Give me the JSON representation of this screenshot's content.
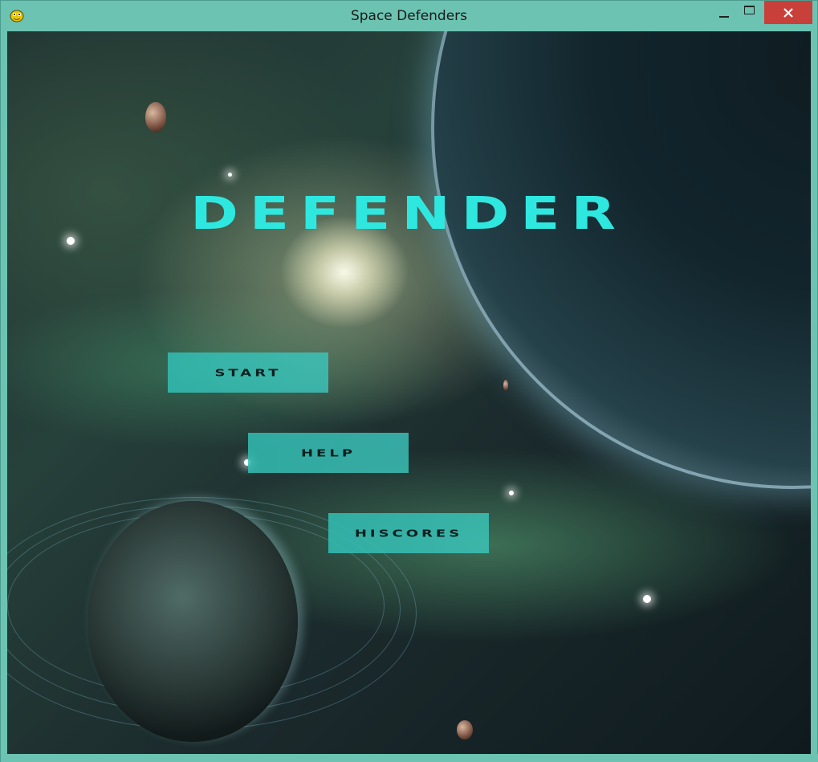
{
  "window": {
    "title": "Space Defenders",
    "app_icon": "pygame-snake-icon",
    "controls": {
      "minimize_icon": "minimize-icon",
      "maximize_icon": "maximize-icon",
      "close_icon": "close-icon",
      "close_color": "#c9403a"
    },
    "frame_color": "#6cc3b2"
  },
  "game": {
    "logo_text": "DEFENDER",
    "logo_color": "#2ee8e0",
    "menu": {
      "start_label": "START",
      "help_label": "HELP",
      "hiscores_label": "HISCORES",
      "button_color": "#32beb4"
    }
  }
}
